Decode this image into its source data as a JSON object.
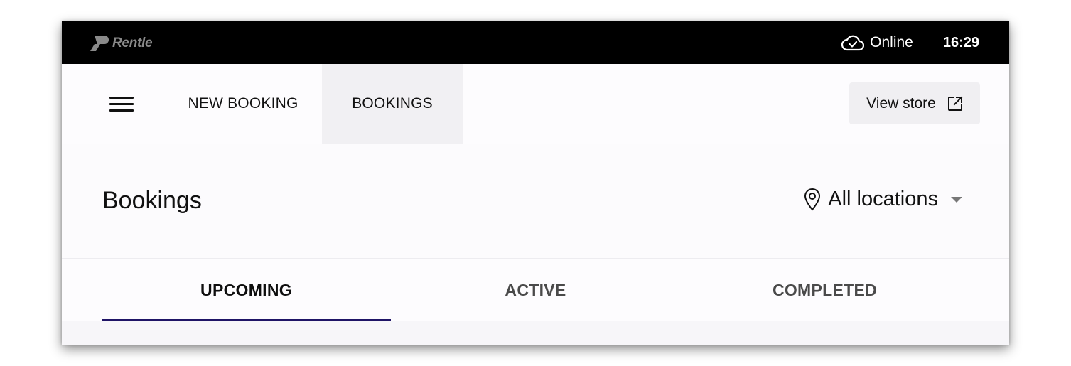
{
  "statusbar": {
    "brand": "Rentle",
    "connection_status": "Online",
    "time": "16:29"
  },
  "nav": {
    "items": [
      {
        "label": "NEW BOOKING",
        "active": false
      },
      {
        "label": "BOOKINGS",
        "active": true
      }
    ],
    "view_store_label": "View store",
    "icons": {
      "menu": "hamburger-menu-icon",
      "external": "external-link-icon",
      "cloud": "cloud-check-icon"
    }
  },
  "page": {
    "title": "Bookings",
    "location_filter": "All locations"
  },
  "tabs": [
    {
      "label": "UPCOMING",
      "active": true
    },
    {
      "label": "ACTIVE",
      "active": false
    },
    {
      "label": "COMPLETED",
      "active": false
    }
  ],
  "colors": {
    "statusbar_bg": "#000000",
    "tab_indicator": "#1f1466",
    "selected_nav_bg": "#f1f0f3"
  }
}
